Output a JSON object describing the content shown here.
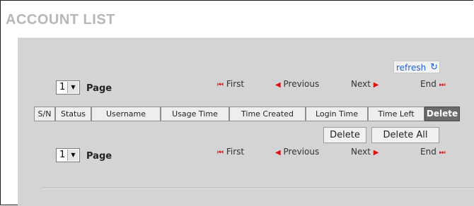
{
  "title": "ACCOUNT LIST",
  "refresh_label": "refresh",
  "top_pager": {
    "page_value": "1",
    "page_label": "Page",
    "first": "First",
    "previous": "Previous",
    "next": "Next",
    "end": "End"
  },
  "table": {
    "columns": [
      "S/N",
      "Status",
      "Username",
      "Usage Time",
      "Time Created",
      "Login Time",
      "Time Left",
      "Delete"
    ]
  },
  "actions": {
    "delete": "Delete",
    "delete_all": "Delete All"
  },
  "bottom_pager": {
    "page_value": "1",
    "page_label": "Page",
    "first": "First",
    "previous": "Previous",
    "next": "Next",
    "end": "End"
  },
  "colors": {
    "title": "#b7b7b7",
    "panel": "#d4d4d4",
    "nav_arrow": "#e01010",
    "link": "#1f5fd6",
    "delete_header": "#6a6a6a"
  }
}
